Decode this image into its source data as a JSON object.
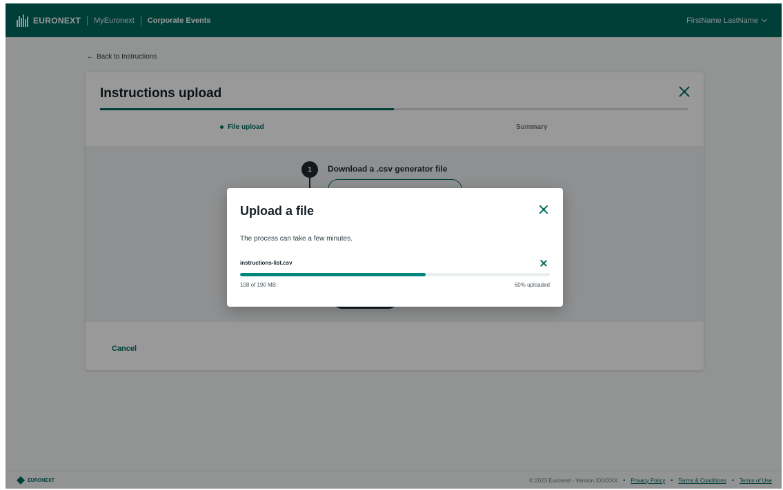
{
  "header": {
    "brand": "EURONEXT",
    "nav": [
      "MyEuronext",
      "Corporate Events"
    ],
    "user_name": "FirstName LastName"
  },
  "back_link": "Back to Instructions",
  "card": {
    "title": "Instructions upload",
    "progress_fraction": 0.5,
    "steps": [
      {
        "label": "File upload",
        "active": true
      },
      {
        "label": "Summary",
        "active": false
      }
    ],
    "step_one": {
      "number": "1",
      "title": "Download a .csv generator file"
    },
    "cancel_label": "Cancel"
  },
  "modal": {
    "title": "Upload a file",
    "description": "The process can take a few minutes.",
    "file_name": "instructions-list.csv",
    "size_text": "108 of 190 MB",
    "percent_text": "60% uploaded",
    "progress_fraction": 0.6
  },
  "footer": {
    "brand": "EURONEXT",
    "copyright": "© 2023 Euronext - Version XXXXXX",
    "links": [
      "Privacy Policy",
      "Terms & Conditions",
      "Terms of Use"
    ]
  },
  "colors": {
    "brand": "#00685e",
    "accent": "#00897b"
  }
}
